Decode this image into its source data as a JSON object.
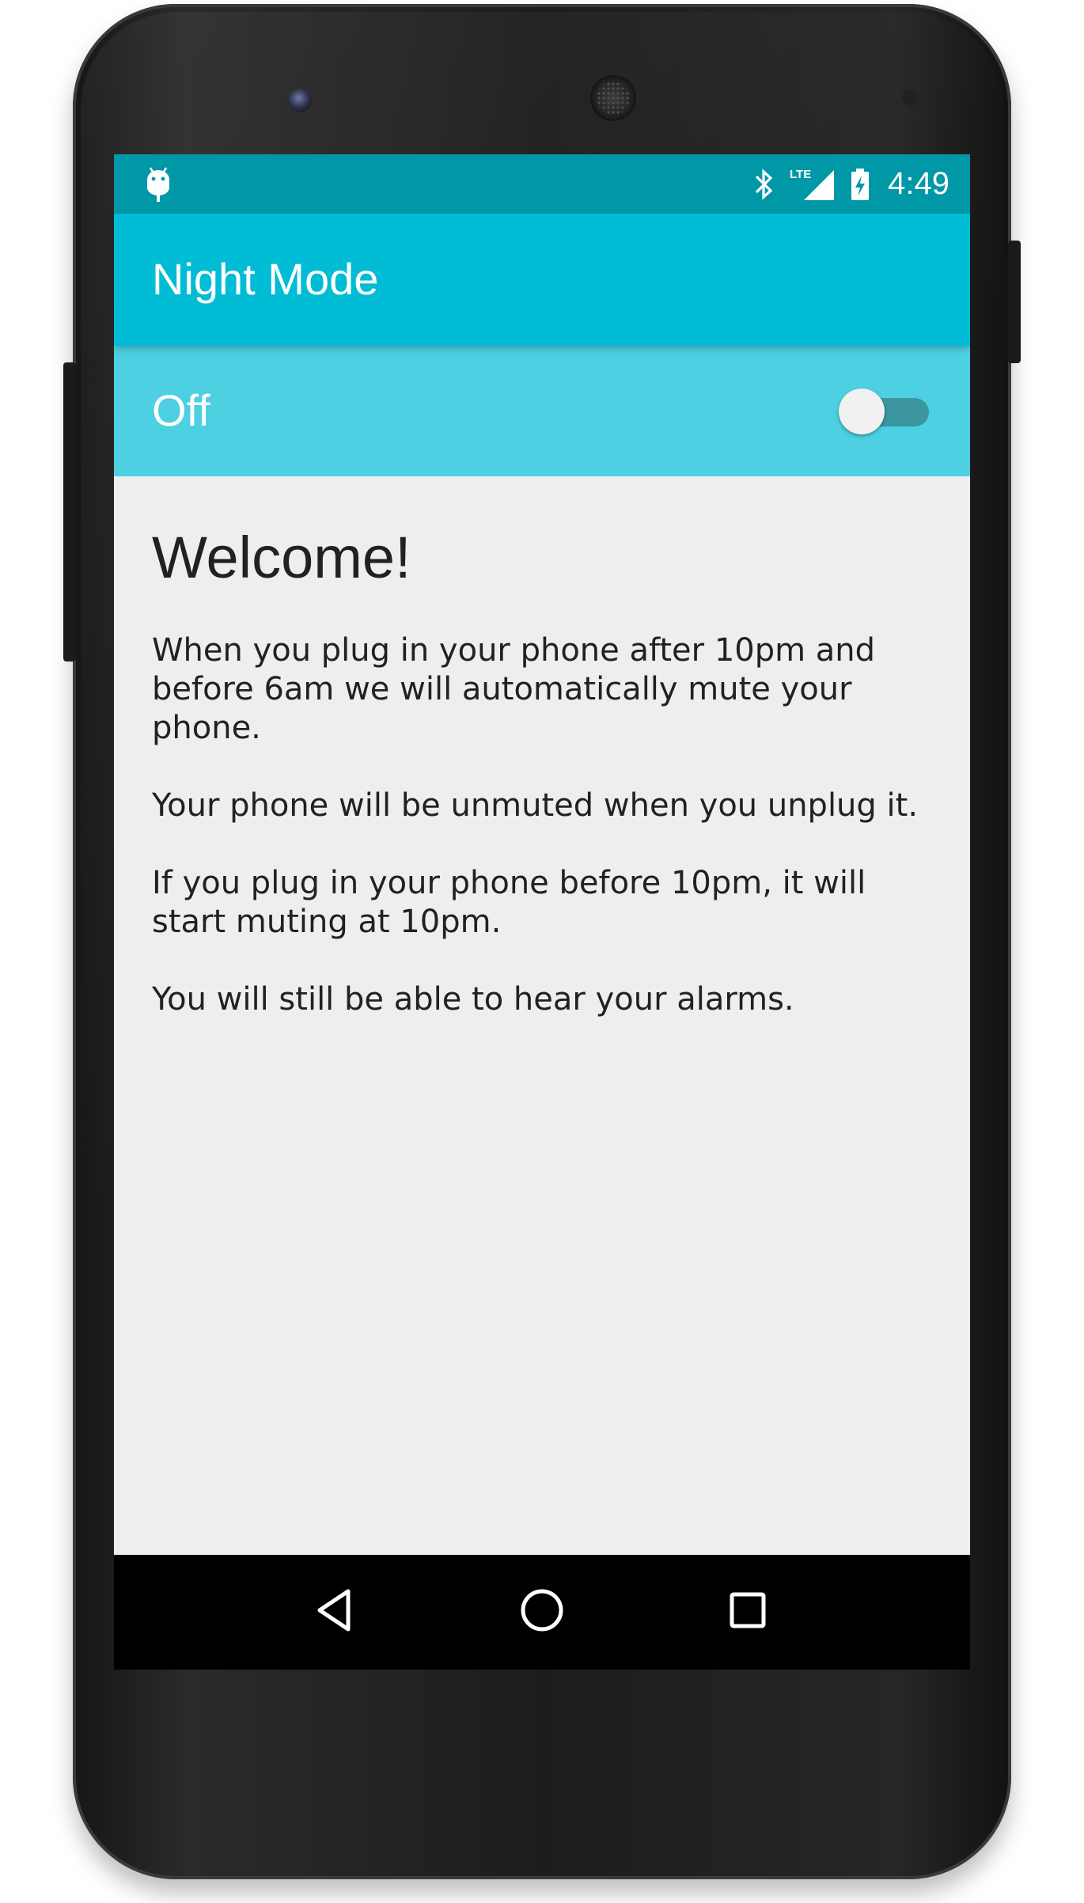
{
  "status_bar": {
    "time": "4:49",
    "network": "LTE",
    "icons": [
      "android-debug-icon",
      "bluetooth-icon",
      "lte-signal-icon",
      "battery-charging-icon"
    ]
  },
  "app_bar": {
    "title": "Night Mode"
  },
  "toggle_bar": {
    "label": "Off",
    "switch_on": false
  },
  "content": {
    "heading": "Welcome!",
    "paragraphs": [
      "When you plug in your phone after 10pm and before 6am we will automatically mute your phone.",
      "Your phone will be unmuted when you unplug it.",
      "If you plug in your phone before 10pm, it will start muting at 10pm.",
      "You will still be able to hear your alarms."
    ]
  },
  "nav_bar": {
    "buttons": [
      "back-button",
      "home-button",
      "recents-button"
    ]
  },
  "colors": {
    "status_bar": "#0097a7",
    "app_bar": "#00bcd4",
    "toggle_bar": "#4dd0e1",
    "content_bg": "#eeeeee",
    "text": "#212121",
    "switch_track": "#3a8f99",
    "switch_thumb": "#f1f1f1"
  }
}
